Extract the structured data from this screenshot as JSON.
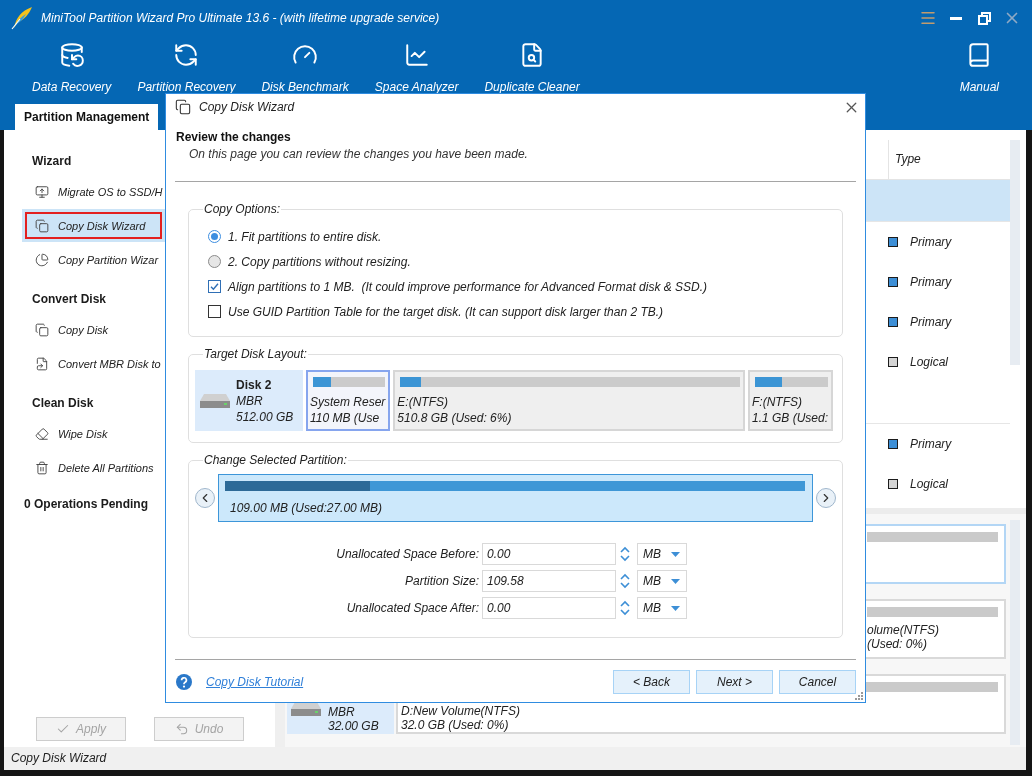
{
  "window": {
    "title": "MiniTool Partition Wizard Pro Ultimate 13.6 - (with lifetime upgrade service)"
  },
  "toolbar": {
    "items": [
      {
        "kind": "data-recovery",
        "label": "Data Recovery"
      },
      {
        "kind": "partition-recovery",
        "label": "Partition Recovery"
      },
      {
        "kind": "disk-benchmark",
        "label": "Disk Benchmark"
      },
      {
        "kind": "space-analyzer",
        "label": "Space Analyzer"
      },
      {
        "kind": "duplicate-cleaner",
        "label": "Duplicate Cleaner"
      }
    ],
    "end_items": [
      {
        "kind": "manual",
        "label": "Manual"
      }
    ]
  },
  "tabs": [
    {
      "label": "Partition Management",
      "selected": true
    }
  ],
  "sidebar": {
    "groups": [
      {
        "title": "Wizard",
        "items": [
          {
            "kind": "migrate",
            "label": "Migrate OS to SSD/H",
            "selected": false,
            "annotated": false
          },
          {
            "kind": "copy-disk",
            "label": "Copy Disk Wizard",
            "selected": true,
            "annotated": true
          },
          {
            "kind": "copy-partition",
            "label": "Copy Partition Wizar",
            "selected": false,
            "annotated": false
          }
        ]
      },
      {
        "title": "Convert Disk",
        "items": [
          {
            "kind": "copy-disk",
            "label": "Copy Disk",
            "selected": false,
            "annotated": false
          },
          {
            "kind": "convert",
            "label": "Convert MBR Disk to",
            "selected": false,
            "annotated": false
          }
        ]
      },
      {
        "title": "Clean Disk",
        "items": [
          {
            "kind": "wipe",
            "label": "Wipe Disk",
            "selected": false,
            "annotated": false
          },
          {
            "kind": "delete",
            "label": "Delete All Partitions",
            "selected": false,
            "annotated": false
          }
        ]
      }
    ],
    "pending": "0 Operations Pending",
    "actions": [
      {
        "kind": "apply",
        "label": "Apply",
        "disabled": true
      },
      {
        "kind": "undo",
        "label": "Undo",
        "disabled": true
      }
    ]
  },
  "partition_table": {
    "columns": [
      {
        "label": "Type"
      }
    ],
    "rows": [
      {
        "kind": "disk",
        "selected": true
      },
      {
        "kind": "partition",
        "type": "Primary",
        "color": "#3d8fd6",
        "selected": false
      },
      {
        "kind": "partition",
        "type": "Primary",
        "color": "#3d8fd6",
        "selected": false
      },
      {
        "kind": "partition",
        "type": "Primary",
        "color": "#3d8fd6",
        "selected": false
      },
      {
        "kind": "partition",
        "type": "Logical",
        "color": "#d4d4d4",
        "selected": false
      },
      {
        "kind": "disk",
        "selected": false
      },
      {
        "kind": "partition",
        "type": "Primary",
        "color": "#3d8fd6",
        "selected": false
      },
      {
        "kind": "partition",
        "type": "Logical",
        "color": "#d4d4d4",
        "selected": false
      }
    ]
  },
  "disk_map": {
    "rows": [
      {
        "partitions": [
          {
            "selected": true
          }
        ]
      },
      {
        "partitions": [
          {
            "selected": false,
            "name": "olume(NTFS)",
            "size": "(Used: 0%)"
          }
        ]
      },
      {
        "disk": {
          "scheme": "MBR",
          "capacity": "32.00 GB"
        },
        "partitions": [
          {
            "selected": false,
            "name": "D:New Volume(NTFS)",
            "size": "32.0 GB (Used: 0%)"
          }
        ]
      }
    ]
  },
  "dialog": {
    "title": "Copy Disk Wizard",
    "heading": "Review the changes",
    "subheading": "On this page you can review the changes you have been made.",
    "copy_options": {
      "legend": "Copy Options:",
      "options": [
        {
          "kind": "radio",
          "label": "1. Fit partitions to entire disk.",
          "selected": true
        },
        {
          "kind": "radio",
          "label": "2. Copy partitions without resizing.",
          "selected": false
        },
        {
          "kind": "checkbox",
          "label": "Align partitions to 1 MB.  (It could improve performance for Advanced Format disk & SSD.)",
          "checked": true
        },
        {
          "kind": "checkbox",
          "label": "Use GUID Partition Table for the target disk. (It can support disk larger than 2 TB.)",
          "checked": false
        }
      ]
    },
    "target_disk_layout": {
      "legend": "Target Disk Layout:",
      "disk": {
        "name": "Disk 2",
        "scheme": "MBR",
        "capacity": "512.00 GB"
      },
      "partitions": [
        {
          "name": "System Reser",
          "size": "110 MB (Use",
          "level": 0.25,
          "selected": true
        },
        {
          "name": "E:(NTFS)",
          "size": "510.8 GB (Used: 6%)",
          "level": 0.06,
          "selected": false
        },
        {
          "name": "F:(NTFS)",
          "size": "1.1 GB (Used:",
          "level": 0.37,
          "selected": false
        }
      ]
    },
    "change_selected_partition": {
      "legend": "Change Selected Partition:",
      "bar": {
        "label": "109.00 MB (Used:27.00 MB)",
        "level": 0.25
      },
      "fields": [
        {
          "label": "Unallocated Space Before:",
          "value": "0.00",
          "unit": "MB"
        },
        {
          "label": "Partition Size:",
          "value": "109.58",
          "unit": "MB"
        },
        {
          "label": "Unallocated Space After:",
          "value": "0.00",
          "unit": "MB"
        }
      ]
    },
    "tutorial_link": "Copy Disk Tutorial",
    "buttons": [
      {
        "label": "< Back"
      },
      {
        "label": "Next >"
      },
      {
        "label": "Cancel"
      }
    ]
  },
  "status_bar": {
    "text": "Copy Disk Wizard"
  }
}
